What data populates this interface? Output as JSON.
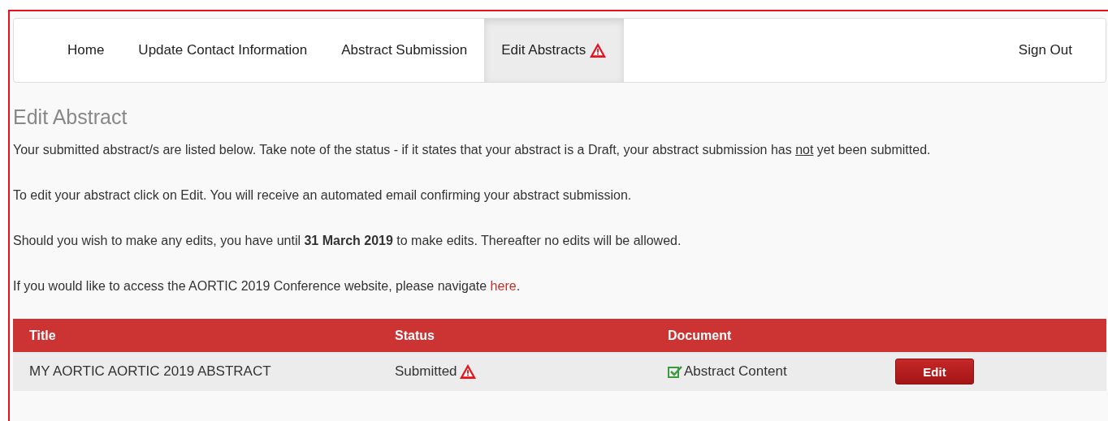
{
  "nav": {
    "items": [
      {
        "label": "Home",
        "selected": false,
        "warning": false
      },
      {
        "label": "Update Contact Information",
        "selected": false,
        "warning": false
      },
      {
        "label": "Abstract Submission",
        "selected": false,
        "warning": false
      },
      {
        "label": "Edit Abstracts",
        "selected": true,
        "warning": true
      }
    ],
    "sign_out": "Sign Out"
  },
  "heading": "Edit Abstract",
  "paragraphs": [
    [
      {
        "kind": "text",
        "text": "Your submitted abstract/s are listed below. Take note of the status - if it states that your abstract is a Draft, your abstract submission has "
      },
      {
        "kind": "underline",
        "text": "not"
      },
      {
        "kind": "text",
        "text": " yet been submitted."
      }
    ],
    [
      {
        "kind": "text",
        "text": "To edit your abstract click on Edit. You will receive an automated email confirming your abstract submission."
      }
    ],
    [
      {
        "kind": "text",
        "text": "Should you wish to make any edits, you have until "
      },
      {
        "kind": "bold",
        "text": "31 March 2019"
      },
      {
        "kind": "text",
        "text": " to make edits. Thereafter no edits will be allowed."
      }
    ],
    [
      {
        "kind": "text",
        "text": "If you would like to access the AORTIC 2019 Conference website, please navigate "
      },
      {
        "kind": "link",
        "text": "here"
      },
      {
        "kind": "text",
        "text": "."
      }
    ]
  ],
  "table": {
    "columns": [
      "Title",
      "Status",
      "Document"
    ],
    "rows": [
      {
        "title": "MY AORTIC AORTIC 2019 ABSTRACT",
        "status": "Submitted",
        "status_warning": true,
        "document": "Abstract Content",
        "document_checked": true,
        "action": "Edit"
      }
    ]
  }
}
